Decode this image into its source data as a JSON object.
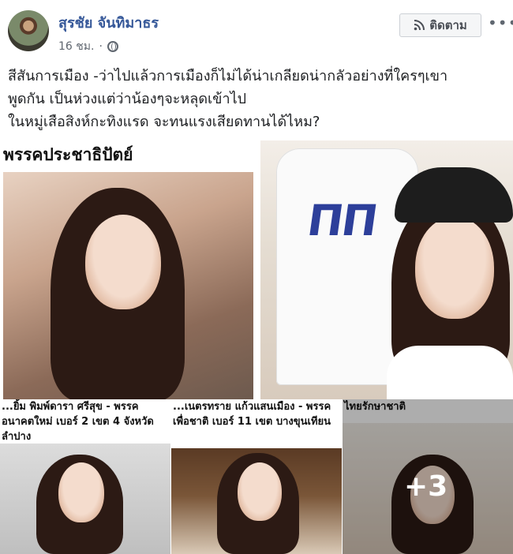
{
  "post": {
    "author": "สุรชัย จันทิมาธร",
    "time": "16 ชม.",
    "privacy_icon": "globe-icon",
    "follow_label": "ติดตาม",
    "follow_icon": "rss-icon",
    "more_label": "•••",
    "text_lines": [
      "สีสันการเมือง -ว่าไปแล้วการเมืองก็ไม่ได้น่าเกลียดน่ากลัวอย่างที่ใครๆเขา",
      "พูดกัน เป็นห่วงแต่ว่าน้องๆจะหลุดเข้าไป",
      "ในหมู่เสือสิงห์กะทิงแรด จะทนแรงเสียดทานได้ไหม?"
    ]
  },
  "photos": [
    {
      "caption": "พรรคประชาธิปัตย์"
    },
    {
      "caption": ""
    },
    {
      "caption": "...ยิ้ม พิมพ์ดารา ศรีสุข - พรรคอนาคตใหม่ เบอร์ 2 เขต 4 จังหวัดลำปาง"
    },
    {
      "caption": "...เนตรทราย แก้วแสนเมือง - พรรคเพื่อชาติ เบอร์ 11 เขต บางขุนเทียน"
    },
    {
      "caption": "ไทยรักษาชาติ"
    }
  ],
  "more_photos_label": "+3",
  "colors": {
    "author_link": "#365899",
    "meta_text": "#606770",
    "button_bg": "#f5f6f7"
  }
}
